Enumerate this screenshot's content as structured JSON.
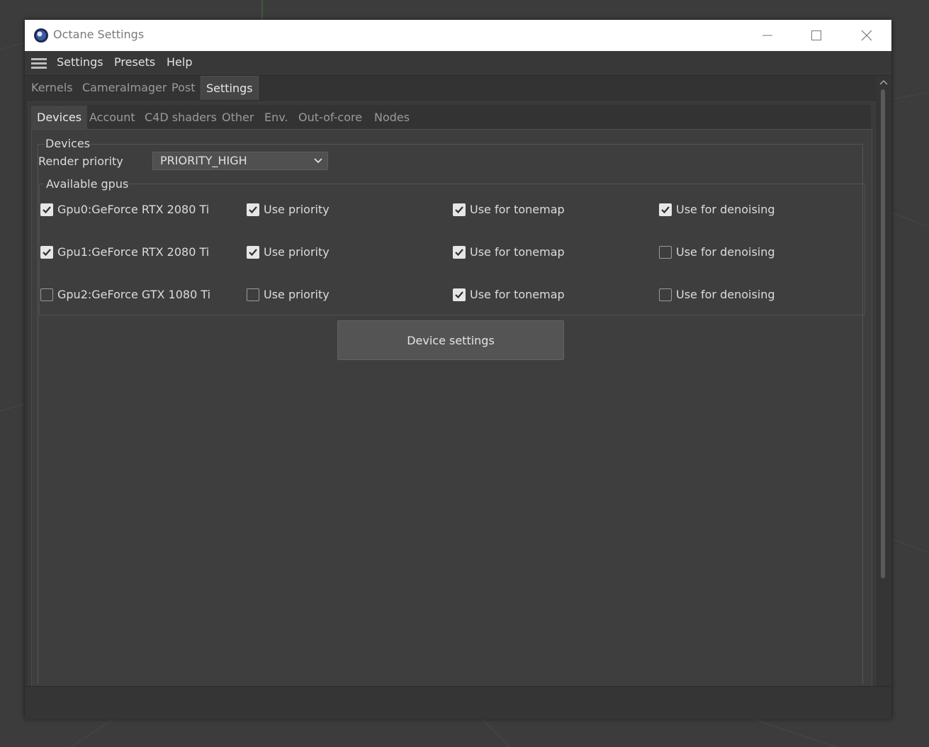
{
  "window": {
    "title": "Octane Settings"
  },
  "menubar": {
    "items": [
      "Settings",
      "Presets",
      "Help"
    ]
  },
  "main_tabs": {
    "items": [
      "Kernels",
      "CameraImager",
      "Post",
      "Settings"
    ],
    "active": "Settings"
  },
  "sub_tabs": {
    "items": [
      "Devices",
      "Account",
      "C4D shaders",
      "Other",
      "Env.",
      "Out-of-core",
      "Nodes"
    ],
    "active": "Devices"
  },
  "devices": {
    "group_label": "Devices",
    "render_priority_label": "Render priority",
    "render_priority_value": "PRIORITY_HIGH",
    "gpus_group_label": "Available gpus",
    "gpus": [
      {
        "name": "Gpu0:GeForce RTX 2080 Ti",
        "enabled": true,
        "use_priority": true,
        "tonemap": true,
        "denoising": true
      },
      {
        "name": "Gpu1:GeForce RTX 2080 Ti",
        "enabled": true,
        "use_priority": true,
        "tonemap": true,
        "denoising": false
      },
      {
        "name": "Gpu2:GeForce GTX 1080 Ti",
        "enabled": false,
        "use_priority": false,
        "tonemap": true,
        "denoising": false
      }
    ],
    "col_labels": {
      "use_priority": "Use priority",
      "tonemap": "Use for tonemap",
      "denoising": "Use for denoising"
    },
    "device_settings_button": "Device settings"
  },
  "colors": {
    "background": "#3c3c3c",
    "panel": "#3e3e3e",
    "titlebar": "#ffffff",
    "text": "#dcdcdc"
  },
  "icons": {
    "app": "octane-logo-icon",
    "menu": "hamburger-icon",
    "window_buttons": [
      "minimize-icon",
      "maximize-icon",
      "close-icon"
    ],
    "dropdown": "chevron-down-icon",
    "checkbox_mark": "check-icon"
  }
}
